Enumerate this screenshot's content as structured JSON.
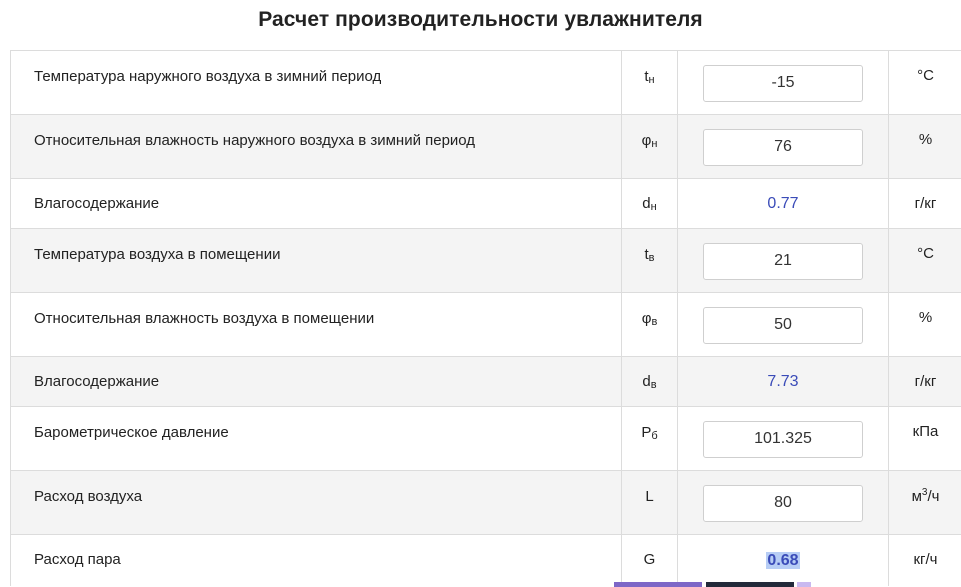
{
  "title": "Расчет производительности увлажнителя",
  "rows": [
    {
      "label": "Температура наружного воздуха в зимний период",
      "symbol_main": "t",
      "symbol_sub": "н",
      "value": "-15",
      "unit": "°C"
    },
    {
      "label": "Относительная влажность наружного воздуха в зимний период",
      "symbol_main": "φ",
      "symbol_sub": "н",
      "value": "76",
      "unit": "%"
    },
    {
      "label": "Влагосодержание",
      "symbol_main": "d",
      "symbol_sub": "н",
      "value": "0.77",
      "unit": "г/кг"
    },
    {
      "label": "Температура воздуха в помещении",
      "symbol_main": "t",
      "symbol_sub": "в",
      "value": "21",
      "unit": "°C"
    },
    {
      "label": "Относительная влажность воздуха в помещении",
      "symbol_main": "φ",
      "symbol_sub": "в",
      "value": "50",
      "unit": "%"
    },
    {
      "label": "Влагосодержание",
      "symbol_main": "d",
      "symbol_sub": "в",
      "value": "7.73",
      "unit": "г/кг"
    },
    {
      "label": "Барометрическое давление",
      "symbol_main": "P",
      "symbol_sub": "б",
      "value": "101.325",
      "unit": "кПа"
    },
    {
      "label": "Расход воздуха",
      "symbol_main": "L",
      "symbol_sub": "",
      "value": "80",
      "unit_main": "м",
      "unit_sup": "3",
      "unit_rest": "/ч"
    },
    {
      "label": "Расход пара",
      "symbol_main": "G",
      "symbol_sub": "",
      "value": "0.68",
      "unit": "кг/ч"
    }
  ],
  "colors": {
    "computed_value": "#3a4bb8",
    "highlight": "#b7cdf5",
    "row_alt": "#f4f4f4",
    "border": "#dcdcdc"
  }
}
